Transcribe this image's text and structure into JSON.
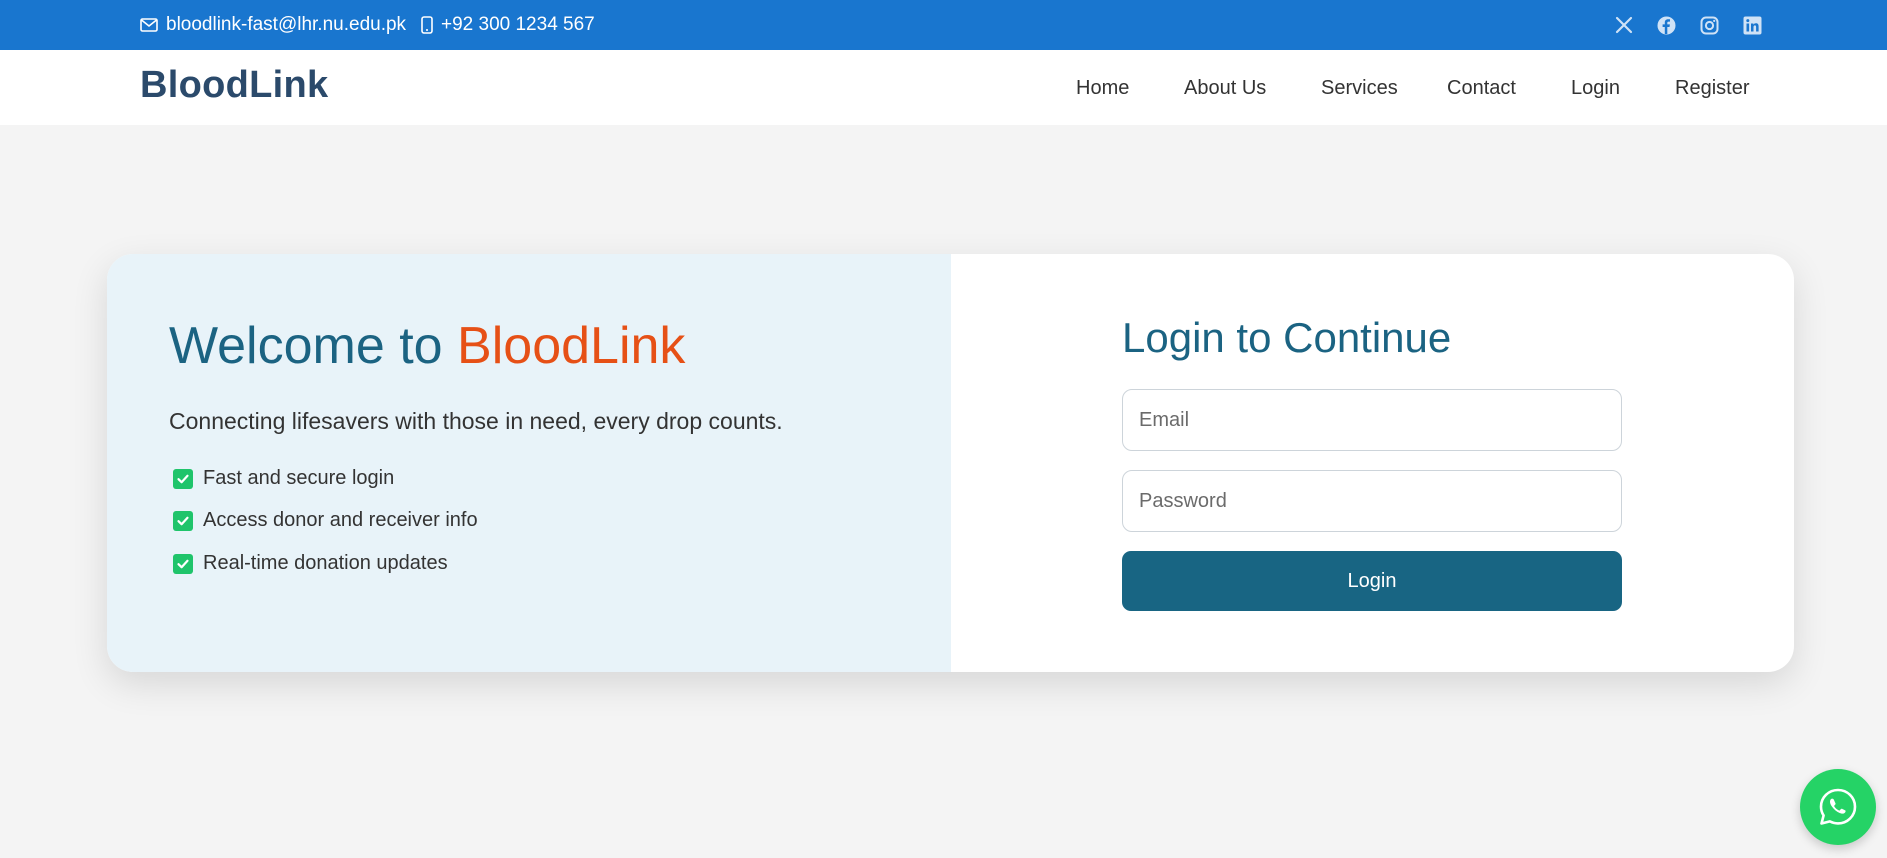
{
  "topbar": {
    "email": "bloodlink-fast@lhr.nu.edu.pk",
    "phone": "+92 300 1234 567",
    "social_icons": [
      "x-icon",
      "facebook-icon",
      "instagram-icon",
      "linkedin-icon"
    ],
    "background": "#1976cf"
  },
  "navbar": {
    "brand": "BloodLink",
    "links": [
      "Home",
      "About Us",
      "Services",
      "Contact",
      "Login",
      "Register"
    ]
  },
  "hero": {
    "welcome_prefix": "Welcome to",
    "welcome_brand": "BloodLink",
    "tagline": "Connecting lifesavers with those in need, every drop counts.",
    "features": [
      "Fast and secure login",
      "Access donor and receiver info",
      "Real-time donation updates"
    ]
  },
  "login": {
    "title": "Login to Continue",
    "email_placeholder": "Email",
    "password_placeholder": "Password",
    "button_label": "Login"
  },
  "colors": {
    "primary": "#186583",
    "accent": "#e65016",
    "check": "#1fc46b",
    "whatsapp": "#25d366"
  },
  "floating": {
    "icon": "whatsapp-icon"
  }
}
